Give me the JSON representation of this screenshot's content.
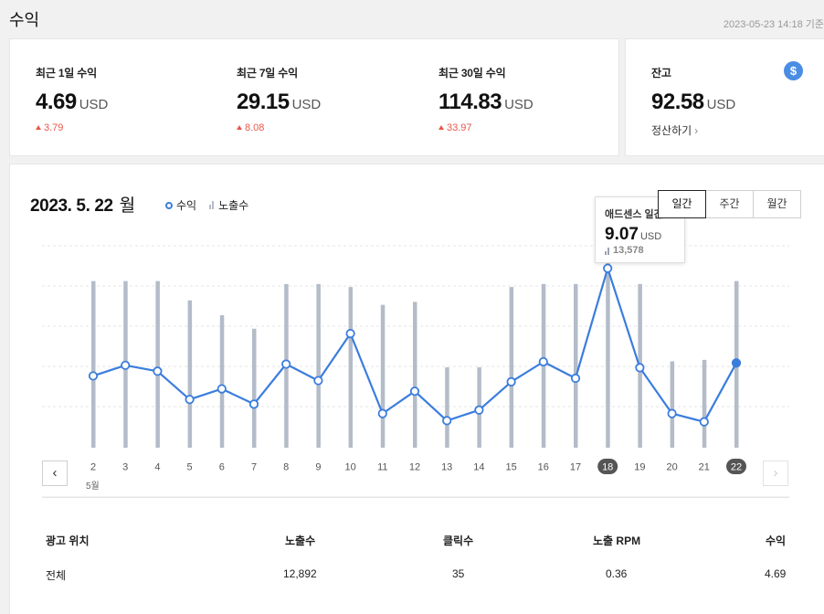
{
  "header": {
    "title": "수익",
    "as_of": "2023-05-23 14:18 기준"
  },
  "stats": [
    {
      "label": "최근 1일 수익",
      "value": "4.69",
      "unit": "USD",
      "delta": "3.79"
    },
    {
      "label": "최근 7일 수익",
      "value": "29.15",
      "unit": "USD",
      "delta": "8.08"
    },
    {
      "label": "최근 30일 수익",
      "value": "114.83",
      "unit": "USD",
      "delta": "33.97"
    }
  ],
  "balance": {
    "label": "잔고",
    "value": "92.58",
    "unit": "USD",
    "link_label": "정산하기",
    "chevron": "›",
    "icon": "dollar-icon",
    "icon_glyph": "$",
    "accent": "#4a8de3"
  },
  "chart": {
    "date": "2023. 5. 22",
    "weekday": "월",
    "legend": {
      "revenue": "수익",
      "impressions": "노출수"
    },
    "tabs": [
      "일간",
      "주간",
      "월간"
    ],
    "active_tab": "일간",
    "month_label": "5월",
    "prev_icon": "‹",
    "next_icon": "›",
    "tooltip": {
      "title": "애드센스 일간",
      "value": "9.07",
      "unit": "USD",
      "impressions": "13,578"
    },
    "colors": {
      "line": "#3b7ddd",
      "bar": "#b3bcc8",
      "badge": "#555555"
    }
  },
  "chart_data": {
    "type": "line",
    "categories": [
      "2",
      "3",
      "4",
      "5",
      "6",
      "7",
      "8",
      "9",
      "10",
      "11",
      "12",
      "13",
      "14",
      "15",
      "16",
      "17",
      "18",
      "19",
      "20",
      "21",
      "22"
    ],
    "series": [
      {
        "name": "수익",
        "values": [
          4.5,
          4.95,
          4.7,
          3.5,
          3.95,
          3.3,
          5.0,
          4.3,
          6.3,
          2.9,
          3.85,
          2.6,
          3.05,
          4.25,
          5.1,
          4.4,
          9.07,
          4.85,
          2.9,
          2.55,
          5.05
        ]
      },
      {
        "name": "노출수",
        "values": [
          11200,
          11200,
          11200,
          9900,
          8900,
          8000,
          11000,
          11000,
          10800,
          9600,
          9800,
          5400,
          5400,
          10800,
          11000,
          11000,
          13578,
          11000,
          5800,
          5900,
          11200
        ]
      }
    ],
    "highlighted": [
      "18",
      "22"
    ]
  },
  "table": {
    "headers": [
      "광고 위치",
      "노출수",
      "클릭수",
      "노출 RPM",
      "수익"
    ],
    "rows": [
      [
        "전체",
        "12,892",
        "35",
        "0.36",
        "4.69"
      ]
    ]
  }
}
